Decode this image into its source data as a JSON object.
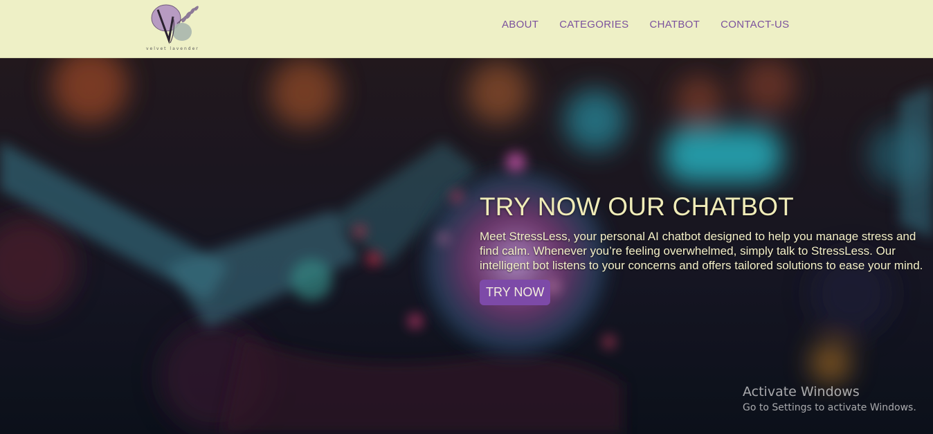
{
  "header": {
    "logo_alt": "Velvet Lavender logo",
    "logo_text": "velvet lavender",
    "nav": [
      "ABOUT",
      "CATEGORIES",
      "CHATBOT",
      "CONTACT-US"
    ]
  },
  "hero": {
    "title": "TRY NOW OUR CHATBOT",
    "description": "Meet StressLess, your personal AI chatbot designed to help you manage stress and find calm. Whenever you’re feeling overwhelmed, simply talk to StressLess. Our intelligent bot listens to your concerns and offers tailored solutions to ease your mind.",
    "button_label": "TRY NOW"
  },
  "watermark": {
    "title": "Activate Windows",
    "subtitle": "Go to Settings to activate Windows."
  },
  "colors": {
    "header_bg": "#eef0c6",
    "nav_text": "#7b519d",
    "accent_button": "#7d4aa8",
    "hero_text": "#f0ecb8"
  }
}
